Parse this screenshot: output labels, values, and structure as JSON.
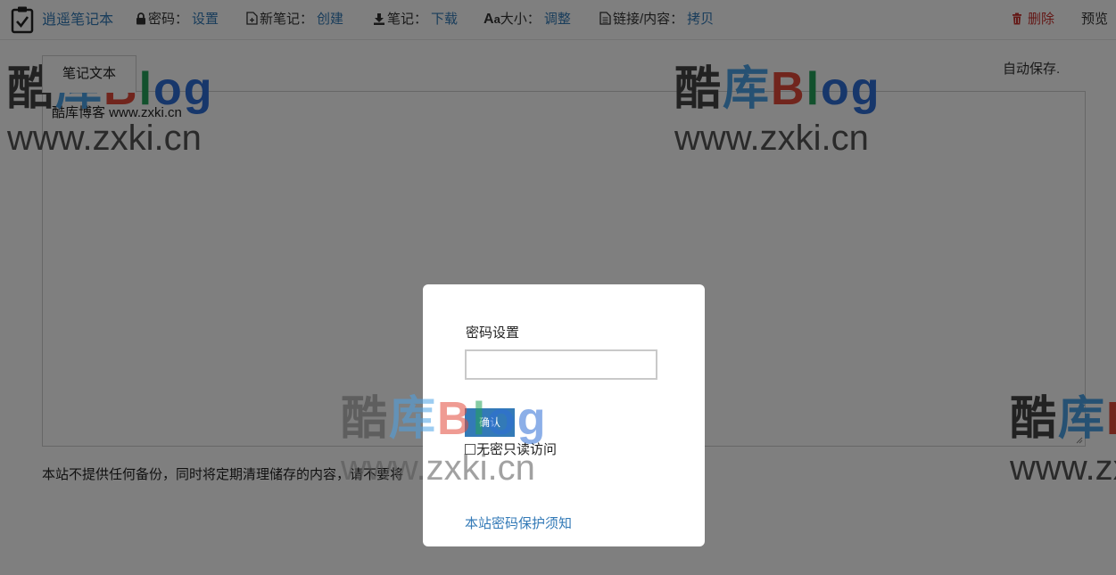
{
  "toolbar": {
    "brand_title": "逍遥笔记本",
    "password": {
      "label": "密码：",
      "action": "设置"
    },
    "new_note": {
      "label": "新笔记：",
      "action": "创建"
    },
    "download": {
      "label": "笔记：",
      "action": "下载"
    },
    "font_size": {
      "label": "大小：",
      "glyph_big": "A",
      "glyph_small": "a",
      "action": "调整"
    },
    "link_content": {
      "label": "链接/内容：",
      "action": "拷贝"
    },
    "delete_label": "删除",
    "preview_label": "预览"
  },
  "main": {
    "tab_label": "笔记文本",
    "autosave_text": "自动保存.",
    "editor_content": "酷库博客 www.zxki.cn",
    "notice_text": "本站不提供任何备份，同时将定期清理储存的内容，请不要将"
  },
  "watermark": {
    "chars": [
      "酷",
      "库",
      "B",
      "l",
      "og"
    ],
    "url": "www.zxki.cn"
  },
  "modal": {
    "title": "密码设置",
    "input_value": "",
    "confirm_label": "确认",
    "readonly_label": "无密只读访问",
    "notice_link": "本站密码保护须知"
  },
  "colors": {
    "link": "#337ab7",
    "danger": "#c9302c",
    "overlay": "rgba(0,0,0,0.5)"
  },
  "icons": [
    "clipboard-check-icon",
    "lock-icon",
    "new-file-icon",
    "download-icon",
    "font-size-icon",
    "file-text-icon",
    "trash-icon"
  ]
}
